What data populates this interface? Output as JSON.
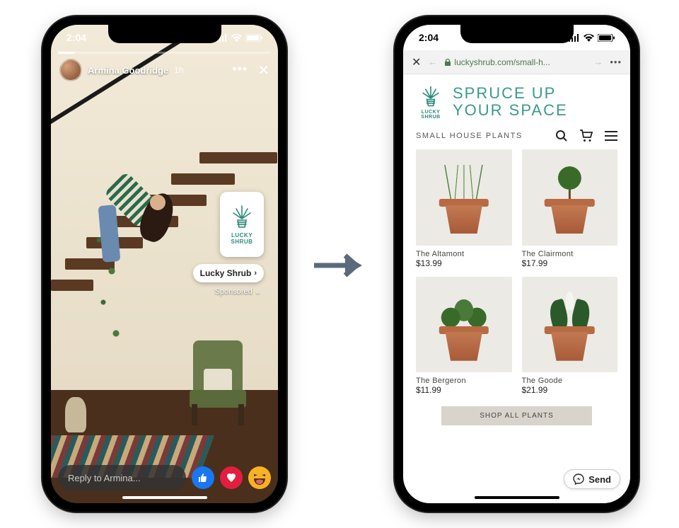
{
  "status": {
    "time": "2:04"
  },
  "story": {
    "user_name": "Armina Goodridge",
    "age_label": "1h",
    "brand_logo_text": "LUCKY SHRUB",
    "brand_pill_label": "Lucky Shrub",
    "sponsored_label": "Sponsored",
    "reply_placeholder": "Reply to Armina..."
  },
  "browser": {
    "url_display": "luckyshrub.com/small-h..."
  },
  "shop": {
    "logo_text": "LUCKY SHRUB",
    "hero_line1": "SPRUCE UP",
    "hero_line2": "YOUR SPACE",
    "category_label": "SMALL HOUSE PLANTS",
    "products": [
      {
        "name": "The Altamont",
        "price": "$13.99"
      },
      {
        "name": "The Clairmont",
        "price": "$17.99"
      },
      {
        "name": "The Bergeron",
        "price": "$11.99"
      },
      {
        "name": "The Goode",
        "price": "$21.99"
      }
    ],
    "cta_label": "SHOP ALL PLANTS",
    "send_label": "Send"
  }
}
